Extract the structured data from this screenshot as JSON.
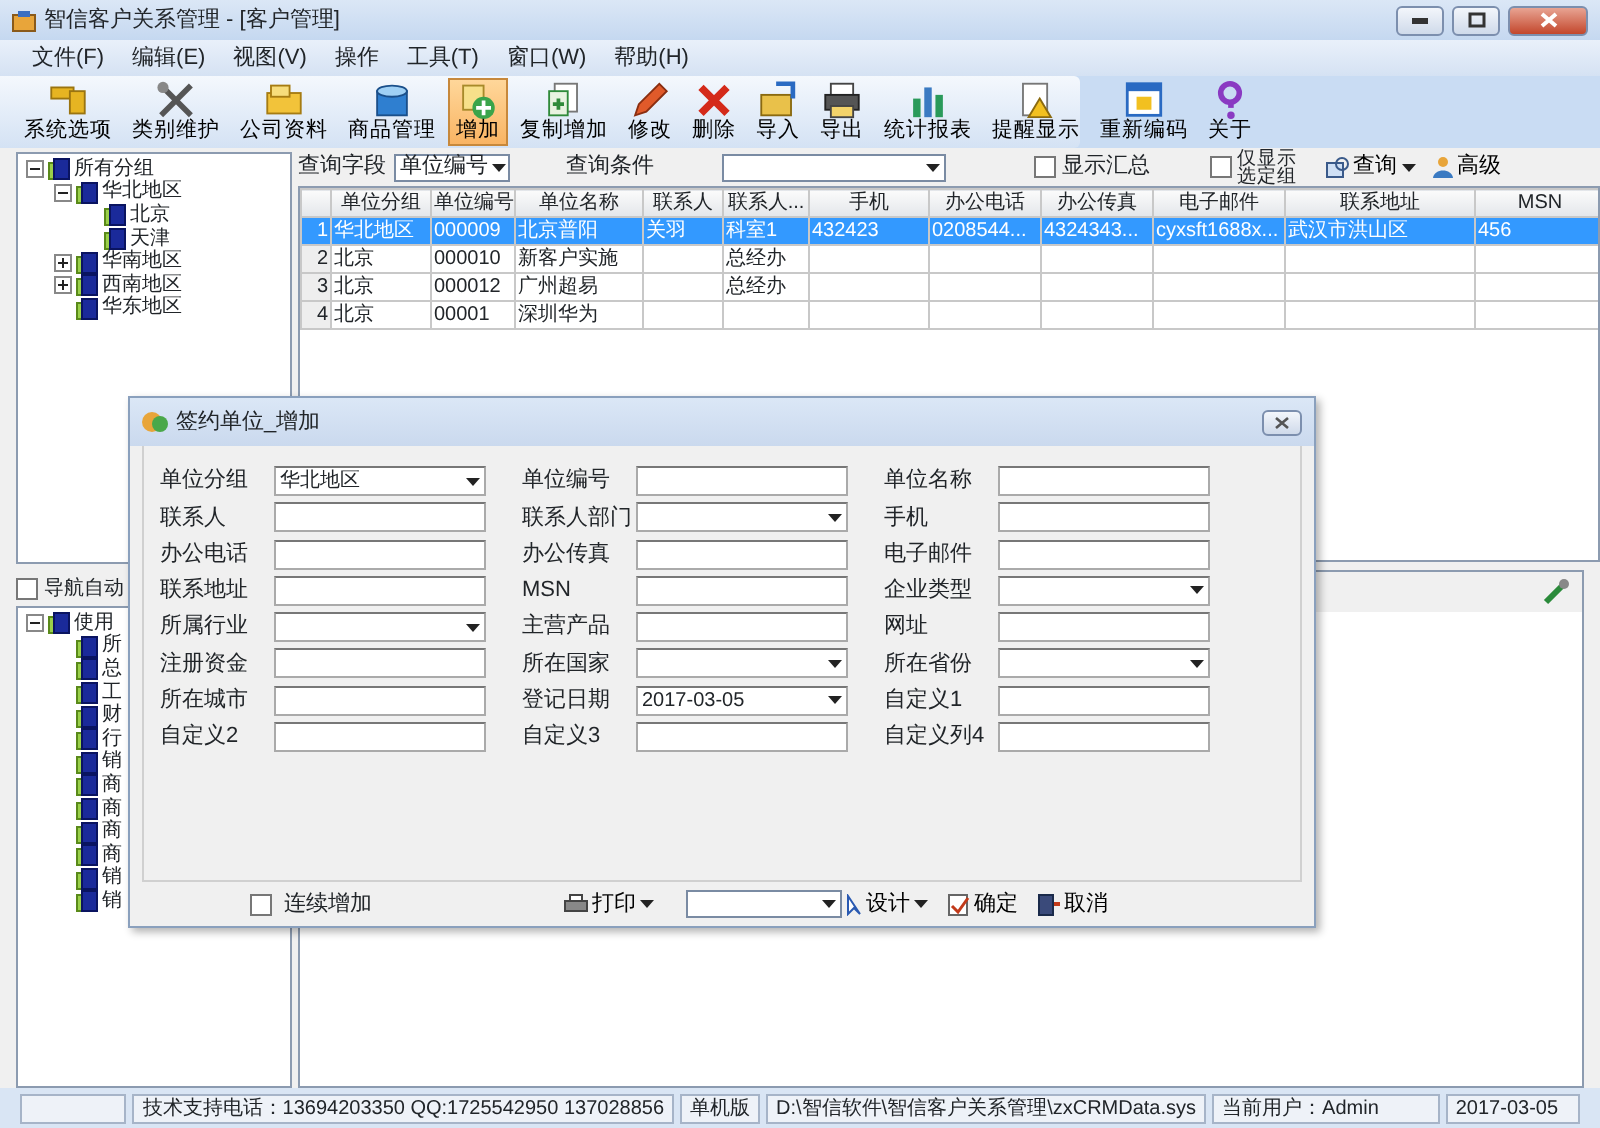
{
  "window": {
    "title": "智信客户关系管理 - [客户管理]"
  },
  "menu": [
    "文件(F)",
    "编辑(E)",
    "视图(V)",
    "操作",
    "工具(T)",
    "窗口(W)",
    "帮助(H)"
  ],
  "toolbar": [
    {
      "label": "系统选项",
      "selected": false
    },
    {
      "label": "类别维护",
      "selected": false
    },
    {
      "label": "公司资料",
      "selected": false
    },
    {
      "label": "商品管理",
      "selected": false
    },
    {
      "label": "增加",
      "selected": true
    },
    {
      "label": "复制增加",
      "selected": false
    },
    {
      "label": "修改",
      "selected": false
    },
    {
      "label": "删除",
      "selected": false
    },
    {
      "label": "导入",
      "selected": false
    },
    {
      "label": "导出",
      "selected": false
    },
    {
      "label": "统计报表",
      "selected": false
    },
    {
      "label": "提醒显示",
      "selected": false
    },
    {
      "label": "重新编码",
      "selected": false
    },
    {
      "label": "关于",
      "selected": false
    }
  ],
  "group_tree": {
    "label": "所有分组",
    "expanded": true,
    "children": [
      {
        "label": "华北地区",
        "expanded": true,
        "children": [
          {
            "label": "北京"
          },
          {
            "label": "天津"
          }
        ]
      },
      {
        "label": "华南地区",
        "expanded": false
      },
      {
        "label": "西南地区",
        "expanded": false
      },
      {
        "label": "华东地区"
      }
    ]
  },
  "nav_auto_group": {
    "label": "导航自动",
    "checked": false
  },
  "dept_tree": {
    "label": "使用",
    "expanded": true,
    "children": [
      {
        "label": "所"
      },
      {
        "label": "总"
      },
      {
        "label": "工"
      },
      {
        "label": "财"
      },
      {
        "label": "行"
      },
      {
        "label": "销"
      },
      {
        "label": "商"
      },
      {
        "label": "商"
      },
      {
        "label": "商"
      },
      {
        "label": "商"
      },
      {
        "label": "销"
      },
      {
        "label": "销"
      }
    ]
  },
  "query": {
    "field_label": "查询字段",
    "field_value": "单位编号",
    "condition_label": "查询条件",
    "show_summary": {
      "label": "显示汇总",
      "checked": false
    },
    "selected_group_only": {
      "label_lines": [
        "仅显示",
        "选定组"
      ],
      "checked": false
    },
    "search_button": "查询",
    "advanced_button": "高级"
  },
  "table": {
    "columns": [
      "单位分组",
      "单位编号",
      "单位名称",
      "联系人",
      "联系人...",
      "手机",
      "办公电话",
      "办公传真",
      "电子邮件",
      "联系地址",
      "MSN"
    ],
    "rows": [
      {
        "number": "1",
        "selected": true,
        "cells": [
          "华北地区",
          "000009",
          "北京普阳",
          "关羽",
          "科室1",
          "432423",
          "0208544...",
          "4324343...",
          "cyxsft1688x...",
          "武汉市洪山区",
          "456"
        ]
      },
      {
        "number": "2",
        "selected": false,
        "cells": [
          "北京",
          "000010",
          "新客户实施",
          "",
          "总经办",
          "",
          "",
          "",
          "",
          "",
          ""
        ]
      },
      {
        "number": "3",
        "selected": false,
        "cells": [
          "北京",
          "000012",
          "广州超易",
          "",
          "总经办",
          "",
          "",
          "",
          "",
          "",
          ""
        ]
      },
      {
        "number": "4",
        "selected": false,
        "cells": [
          "北京",
          "00001",
          "深圳华为",
          "",
          "",
          "",
          "",
          "",
          "",
          "",
          ""
        ]
      }
    ]
  },
  "dialog": {
    "title": "签约单位_增加",
    "fields": [
      {
        "label": "单位分组",
        "kind": "select",
        "value": "华北地区"
      },
      {
        "label": "单位编号",
        "kind": "text"
      },
      {
        "label": "单位名称",
        "kind": "text"
      },
      {
        "label": "联系人",
        "kind": "text"
      },
      {
        "label": "联系人部门",
        "kind": "select"
      },
      {
        "label": "手机",
        "kind": "text"
      },
      {
        "label": "办公电话",
        "kind": "text"
      },
      {
        "label": "办公传真",
        "kind": "text"
      },
      {
        "label": "电子邮件",
        "kind": "text"
      },
      {
        "label": "联系地址",
        "kind": "text"
      },
      {
        "label": "MSN",
        "kind": "text"
      },
      {
        "label": "企业类型",
        "kind": "select"
      },
      {
        "label": "所属行业",
        "kind": "select"
      },
      {
        "label": "主营产品",
        "kind": "text"
      },
      {
        "label": "网址",
        "kind": "text"
      },
      {
        "label": "注册资金",
        "kind": "text"
      },
      {
        "label": "所在国家",
        "kind": "select"
      },
      {
        "label": "所在省份",
        "kind": "select"
      },
      {
        "label": "所在城市",
        "kind": "text"
      },
      {
        "label": "登记日期",
        "kind": "select",
        "value": "2017-03-05"
      },
      {
        "label": "自定义1",
        "kind": "text"
      },
      {
        "label": "自定义2",
        "kind": "text"
      },
      {
        "label": "自定义3",
        "kind": "text"
      },
      {
        "label": "自定义列4",
        "kind": "text"
      }
    ],
    "continuous_add": {
      "label": "连续增加",
      "checked": false
    },
    "print_button": "打印",
    "design_button": "设计",
    "ok_button": "确定",
    "cancel_button": "取消"
  },
  "status_bar": [
    "技术支持电话：13694203350 QQ:1725542950 137028856",
    "单机版",
    "D:\\智信软件\\智信客户关系管理\\zxCRMData.sys",
    "当前用户：Admin",
    "2017-03-05"
  ]
}
